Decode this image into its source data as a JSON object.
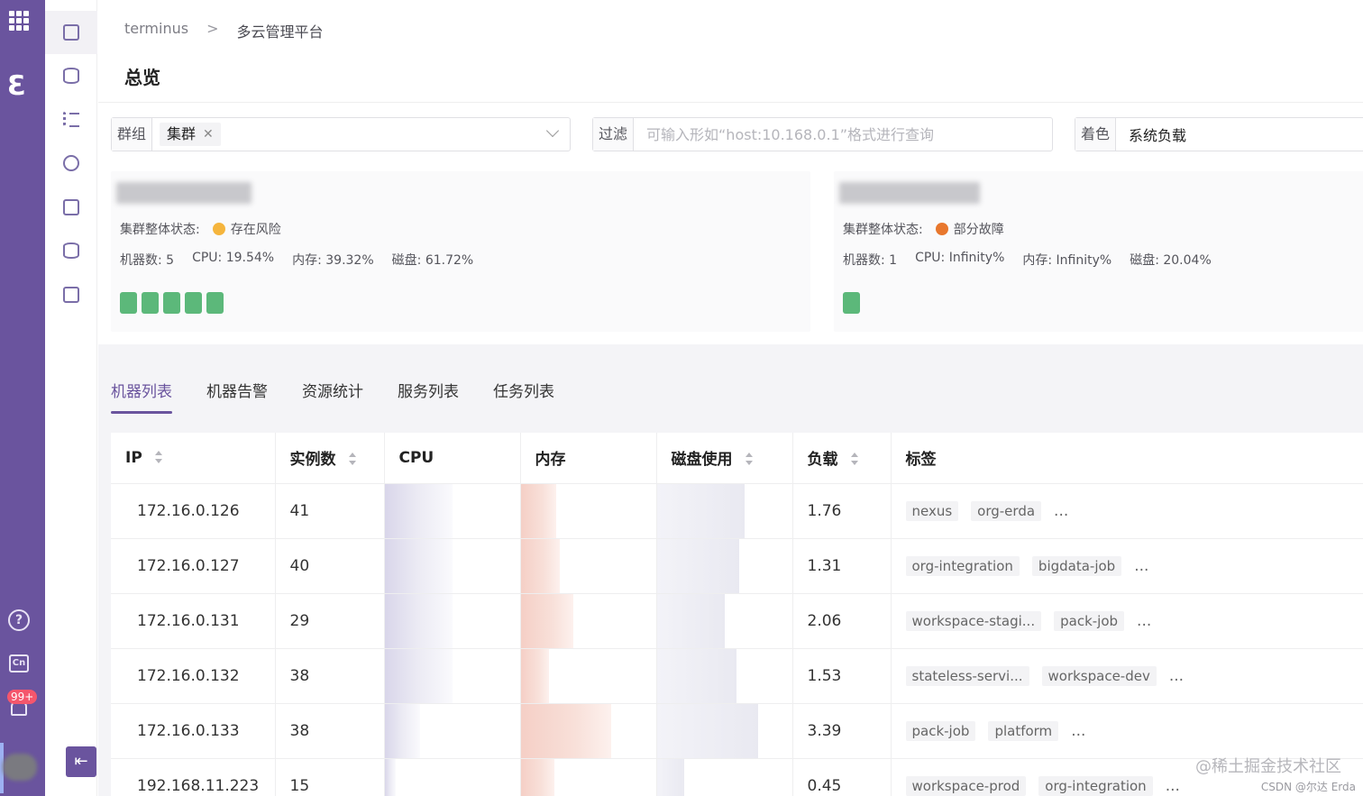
{
  "breadcrumb": {
    "root": "terminus",
    "current": "多云管理平台"
  },
  "page_title": "总览",
  "filters": {
    "group_label": "群组",
    "group_chip": "集群",
    "filter_label": "过滤",
    "filter_placeholder": "可输入形如“host:10.168.0.1”格式进行查询",
    "color_label": "着色",
    "color_value": "系统负载"
  },
  "clusters": [
    {
      "status_label": "集群整体状态:",
      "status_text": "存在风险",
      "status_color": "#f5b53d",
      "machines": "机器数: 5",
      "cpu": "CPU: 19.54%",
      "mem": "内存: 39.32%",
      "disk": "磁盘: 61.72%",
      "machine_count": 5
    },
    {
      "status_label": "集群整体状态:",
      "status_text": "部分故障",
      "status_color": "#e8772d",
      "machines": "机器数: 1",
      "cpu": "CPU: Infinity%",
      "mem": "内存: Infinity%",
      "disk": "磁盘: 20.04%",
      "machine_count": 1
    }
  ],
  "tabs": [
    "机器列表",
    "机器告警",
    "资源统计",
    "服务列表",
    "任务列表"
  ],
  "active_tab": "机器列表",
  "table": {
    "headers": {
      "ip": "IP",
      "instances": "实例数",
      "cpu": "CPU",
      "mem": "内存",
      "disk": "磁盘使用",
      "load": "负载",
      "labels": "标签"
    },
    "rows": [
      {
        "ip": "172.16.0.126",
        "instances": "41",
        "cpu": 0.5,
        "mem": 0.26,
        "disk": 0.65,
        "load": "1.76",
        "labels": [
          "nexus",
          "org-erda"
        ]
      },
      {
        "ip": "172.16.0.127",
        "instances": "40",
        "cpu": 0.5,
        "mem": 0.29,
        "disk": 0.61,
        "load": "1.31",
        "labels": [
          "org-integration",
          "bigdata-job"
        ]
      },
      {
        "ip": "172.16.0.131",
        "instances": "29",
        "cpu": 0.5,
        "mem": 0.39,
        "disk": 0.5,
        "load": "2.06",
        "labels": [
          "workspace-stagi...",
          "pack-job"
        ]
      },
      {
        "ip": "172.16.0.132",
        "instances": "38",
        "cpu": 0.5,
        "mem": 0.21,
        "disk": 0.59,
        "load": "1.53",
        "labels": [
          "stateless-servi...",
          "workspace-dev"
        ]
      },
      {
        "ip": "172.16.0.133",
        "instances": "38",
        "cpu": 0.26,
        "mem": 0.67,
        "disk": 0.75,
        "load": "3.39",
        "labels": [
          "pack-job",
          "platform"
        ]
      },
      {
        "ip": "192.168.11.223",
        "instances": "15",
        "cpu": 0.08,
        "mem": 0.25,
        "disk": 0.2,
        "load": "0.45",
        "labels": [
          "workspace-prod",
          "org-integration"
        ]
      }
    ],
    "more": "..."
  },
  "notifications": {
    "badge": "99+"
  },
  "rail": {
    "help_glyph": "?",
    "lang_glyph": "Cn"
  },
  "watermark": {
    "main": "@稀土掘金技术社区",
    "sub": "CSDN @尔达 Erda"
  }
}
